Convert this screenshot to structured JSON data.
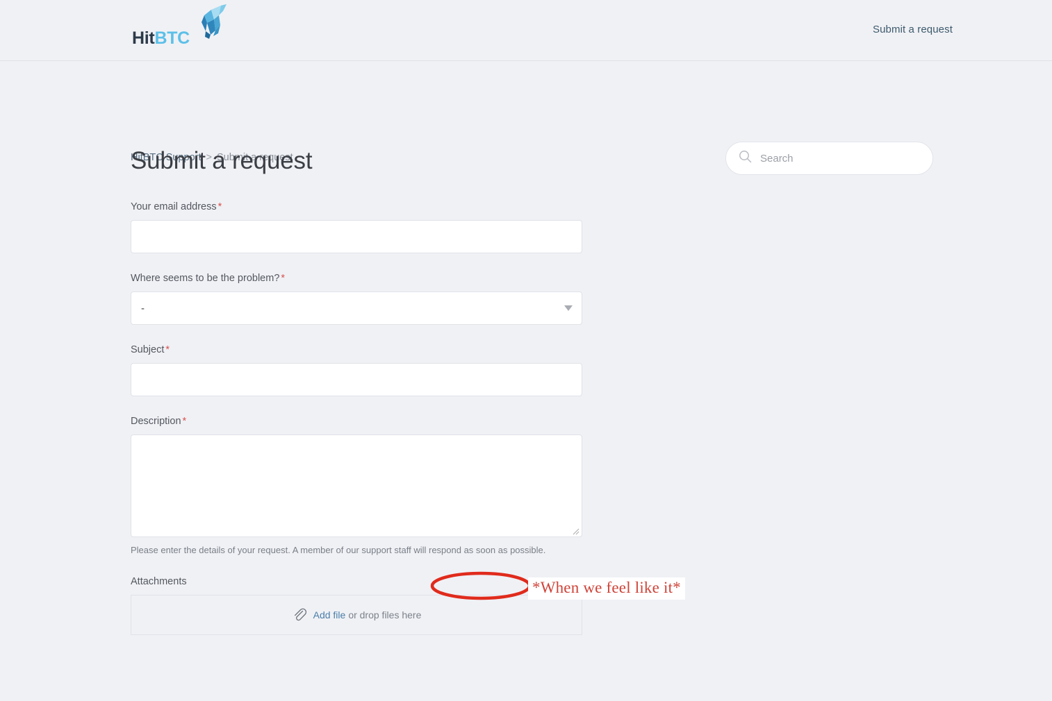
{
  "header": {
    "logo": {
      "part1": "Hit",
      "part2": "BTC",
      "icon": "bull-head-icon"
    },
    "submit_request_link": "Submit a request"
  },
  "breadcrumb": {
    "root": "HitBTC Support",
    "separator": ">",
    "current": "Submit a request"
  },
  "search": {
    "placeholder": "Search",
    "value": "",
    "icon": "search-icon"
  },
  "main": {
    "title": "Submit a request"
  },
  "form": {
    "email": {
      "label": "Your email address",
      "required_marker": "*",
      "value": "",
      "placeholder": ""
    },
    "problem": {
      "label": "Where seems to be the problem?",
      "required_marker": "*",
      "selected": "-",
      "options": [
        "-"
      ]
    },
    "subject": {
      "label": "Subject",
      "required_marker": "*",
      "value": "",
      "placeholder": ""
    },
    "description": {
      "label": "Description",
      "required_marker": "*",
      "value": "",
      "placeholder": "",
      "help_text": "Please enter the details of your request. A member of our support staff will respond as soon as possible."
    },
    "attachments": {
      "label": "Attachments",
      "add_file_link": "Add file",
      "drop_hint": "or drop files here",
      "icon": "paperclip-icon"
    }
  },
  "annotation": {
    "circled_phrase": "as soon as possible.",
    "note_text": "*When we feel like it*",
    "circle_color": "#e02b1c",
    "note_color": "#cf4339"
  },
  "colors": {
    "page_background": "#f0f1f5",
    "input_background": "#ffffff",
    "input_border": "#e0e2e8",
    "required_asterisk": "#d9534f",
    "link_blue": "#4a7ea8",
    "logo_dark": "#2b3a4a",
    "logo_light": "#5cc0e8"
  }
}
